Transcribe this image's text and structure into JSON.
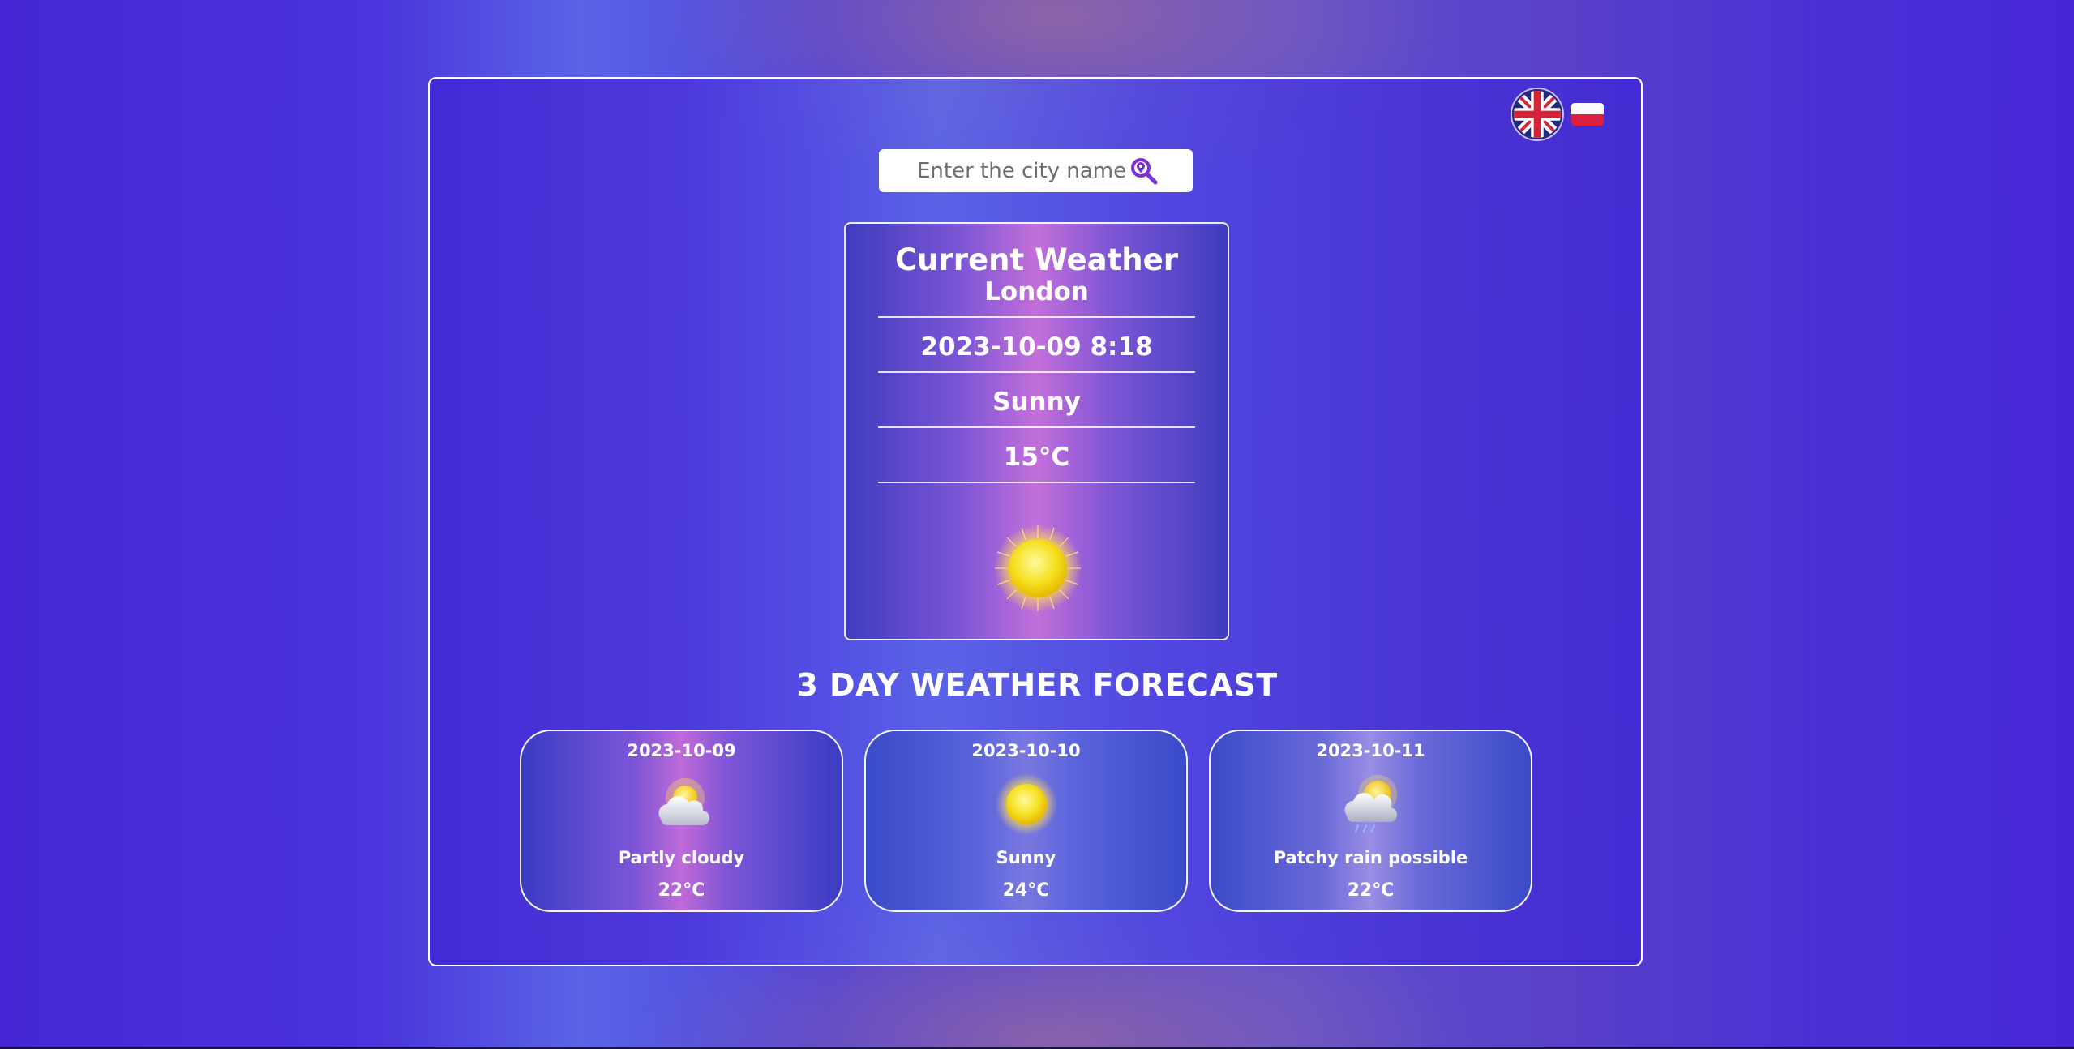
{
  "language": {
    "options": [
      {
        "code": "en",
        "icon": "uk-flag-icon"
      },
      {
        "code": "pl",
        "icon": "poland-flag-icon"
      }
    ],
    "selected": "en"
  },
  "search": {
    "placeholder": "Enter the city name",
    "value": "",
    "icon": "location-search-icon"
  },
  "current": {
    "title": "Current Weather",
    "city": "London",
    "datetime": "2023-10-09 8:18",
    "condition": "Sunny",
    "temperature": "15°C",
    "icon": "sun-icon"
  },
  "forecast": {
    "title": "3 DAY WEATHER FORECAST",
    "days": [
      {
        "date": "2023-10-09",
        "condition": "Partly cloudy",
        "temperature": "22°C",
        "icon": "partly-cloudy-icon"
      },
      {
        "date": "2023-10-10",
        "condition": "Sunny",
        "temperature": "24°C",
        "icon": "sun-icon"
      },
      {
        "date": "2023-10-11",
        "condition": "Patchy rain possible",
        "temperature": "22°C",
        "icon": "patchy-rain-icon"
      }
    ]
  },
  "colors": {
    "background_primary": "#4626d4",
    "background_glow": "#a06e96",
    "card_highlight": "#c36fd9",
    "search_icon": "#7a2fd8",
    "border": "#ffffff",
    "text": "#ffffff"
  }
}
